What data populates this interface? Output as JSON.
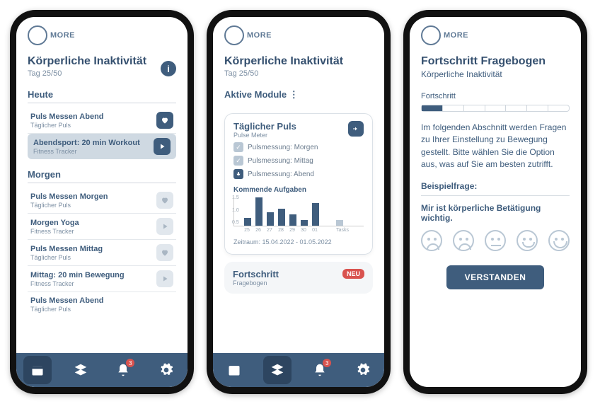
{
  "logo": "MORE",
  "phone1": {
    "title": "Körperliche Inaktivität",
    "day": "Tag 25/50",
    "today_label": "Heute",
    "tomorrow_label": "Morgen",
    "items_today": [
      {
        "title": "Puls Messen Abend",
        "sub": "Täglicher Puls",
        "icon": "heart"
      },
      {
        "title": "Abendsport: 20 min Workout",
        "sub": "Fitness Tracker",
        "icon": "play",
        "highlight": true
      }
    ],
    "items_tomorrow": [
      {
        "title": "Puls Messen Morgen",
        "sub": "Täglicher Puls",
        "icon": "heart-ghost"
      },
      {
        "title": "Morgen Yoga",
        "sub": "Fitness Tracker",
        "icon": "play-ghost"
      },
      {
        "title": "Puls Messen Mittag",
        "sub": "Täglicher Puls",
        "icon": "heart-ghost"
      },
      {
        "title": "Mittag: 20 min Bewegung",
        "sub": "Fitness Tracker",
        "icon": "play-ghost"
      },
      {
        "title": "Puls Messen Abend",
        "sub": "Täglicher Puls",
        "icon": "heart-ghost"
      }
    ],
    "nav_badge": "3"
  },
  "phone2": {
    "title": "Körperliche Inaktivität",
    "day": "Tag 25/50",
    "active_modules": "Aktive Module ⋮",
    "card_title": "Täglicher Puls",
    "card_sub": "Pulse Meter",
    "checks": [
      {
        "label": "Pulsmessung: Morgen",
        "state": "done"
      },
      {
        "label": "Pulsmessung: Mittag",
        "state": "done"
      },
      {
        "label": "Pulsmessung: Abend",
        "state": "mic"
      }
    ],
    "upcoming_label": "Kommende Aufgaben",
    "date_range": "Zeitraum: 15.04.2022 - 01.05.2022",
    "next_card_title": "Fortschritt",
    "next_card_sub": "Fragebogen",
    "neu": "NEU",
    "nav_badge": "3"
  },
  "phone3": {
    "title": "Fortschritt Fragebogen",
    "subtitle": "Körperliche Inaktivität",
    "progress_label": "Fortschritt",
    "body": "Im folgenden Abschnitt werden Fragen zu Ihrer Einstellung zu Bewegung gestellt. Bitte wählen Sie die Option aus, was auf Sie am besten zutrifft.",
    "example_label": "Beispielfrage:",
    "question": "Mir ist körperliche Betätigung wichtig.",
    "button": "VERSTANDEN"
  },
  "chart_data": {
    "type": "bar",
    "categories": [
      "25",
      "26",
      "27",
      "28",
      "29",
      "30",
      "01"
    ],
    "values": [
      0.4,
      1.5,
      0.7,
      0.9,
      0.6,
      0.3,
      1.2
    ],
    "extra_category": "Tasks",
    "extra_value": 0.3,
    "ylim": [
      0,
      1.5
    ],
    "yticks": [
      "0.5",
      "1.0",
      "1.5"
    ],
    "title": "Kommende Aufgaben"
  }
}
